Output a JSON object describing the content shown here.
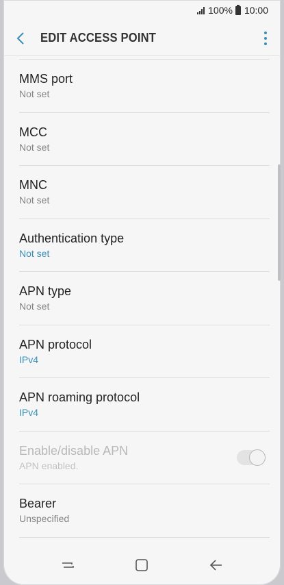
{
  "status_bar": {
    "battery": "100%",
    "time": "10:00"
  },
  "header": {
    "title": "EDIT ACCESS POINT"
  },
  "items": [
    {
      "label": "MMS port",
      "value": "Not set"
    },
    {
      "label": "MCC",
      "value": "Not set"
    },
    {
      "label": "MNC",
      "value": "Not set"
    },
    {
      "label": "Authentication type",
      "value": "Not set"
    },
    {
      "label": "APN type",
      "value": "Not set"
    },
    {
      "label": "APN protocol",
      "value": "IPv4"
    },
    {
      "label": "APN roaming protocol",
      "value": "IPv4"
    },
    {
      "label": "Enable/disable APN",
      "value": "APN enabled."
    },
    {
      "label": "Bearer",
      "value": "Unspecified"
    }
  ],
  "colors": {
    "accent": "#3a8fb7",
    "background": "#f6f6f6",
    "disabled_text": "#b8b8b8"
  },
  "icons": {
    "back": "chevron-left-icon",
    "more": "more-vertical-icon",
    "recents": "recents-icon",
    "home": "home-icon",
    "nav_back": "arrow-left-icon"
  }
}
